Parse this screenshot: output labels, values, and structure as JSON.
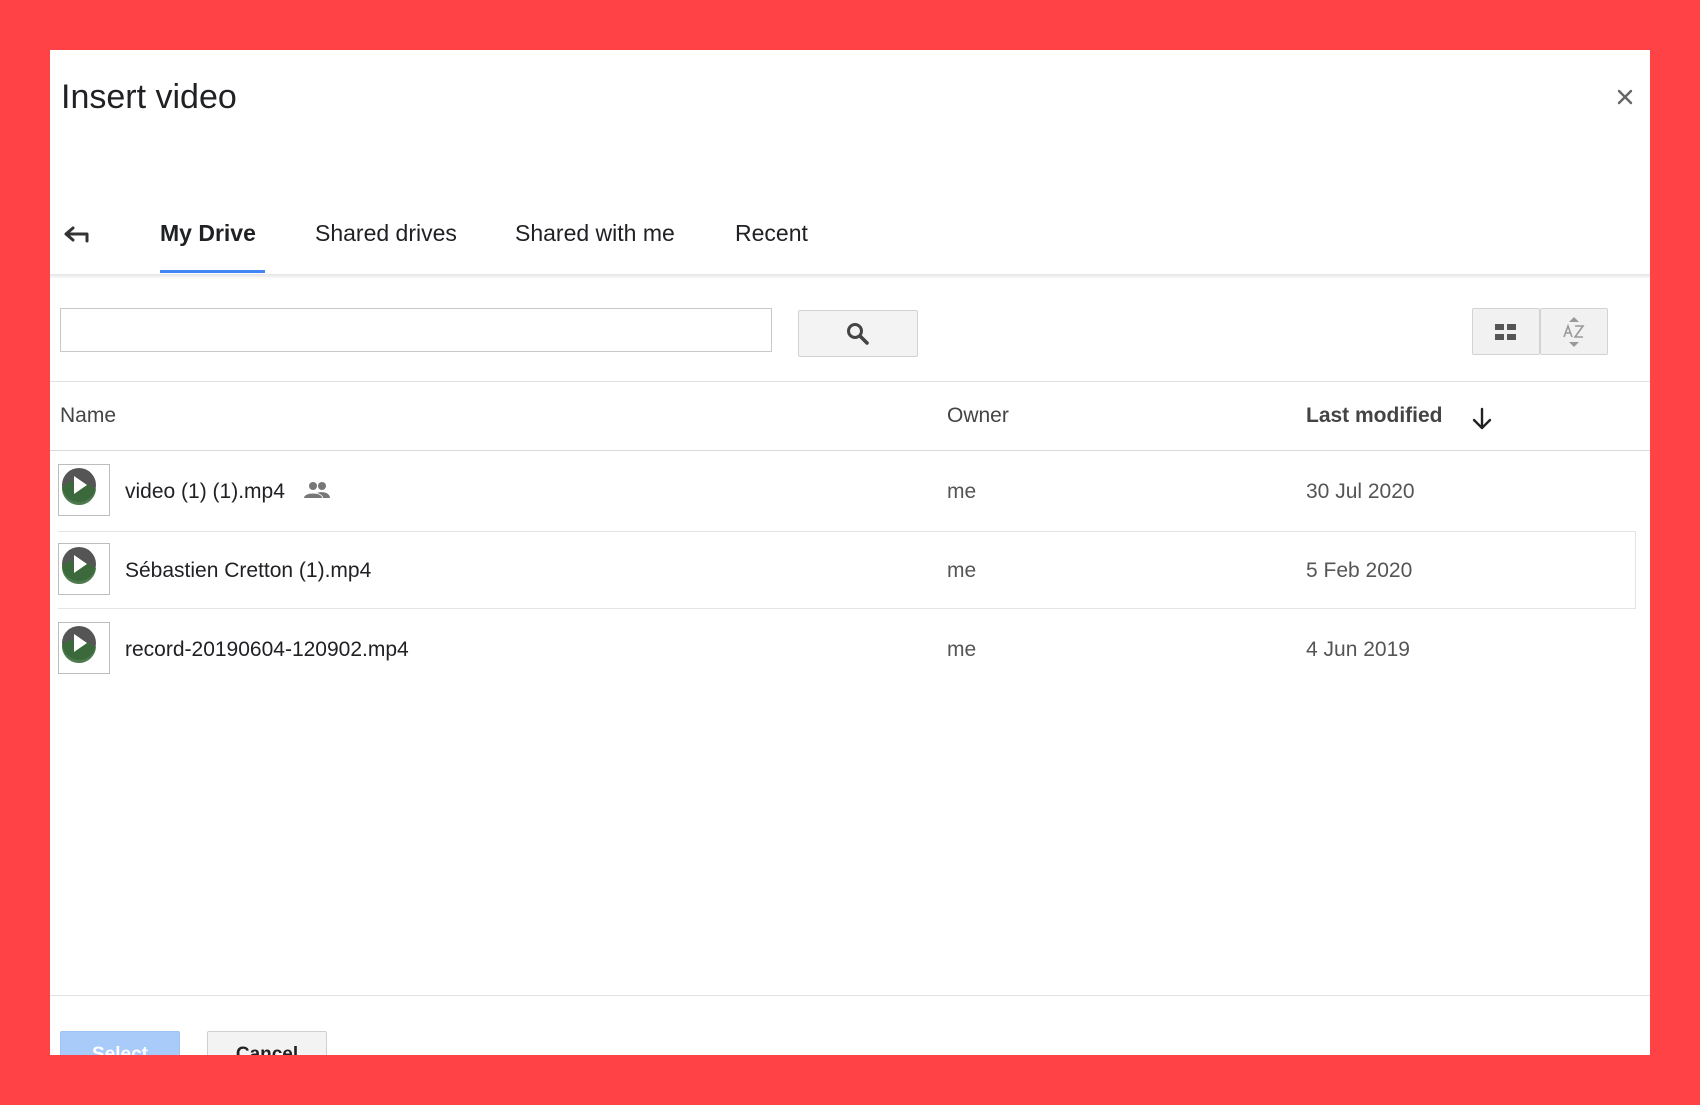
{
  "dialog": {
    "title": "Insert video",
    "close_icon": "close-icon",
    "back_icon": "back-arrow-icon"
  },
  "tabs": [
    {
      "label": "My Drive",
      "active": true
    },
    {
      "label": "Shared drives",
      "active": false
    },
    {
      "label": "Shared with me",
      "active": false
    },
    {
      "label": "Recent",
      "active": false
    }
  ],
  "toolbar": {
    "search_value": "",
    "search_icon": "search-icon",
    "grid_view_icon": "grid-view-icon",
    "sort_az_icon": "sort-az-icon"
  },
  "columns": {
    "name": "Name",
    "owner": "Owner",
    "last_modified": "Last modified",
    "sort_icon": "arrow-down-icon"
  },
  "files": [
    {
      "name": "video (1) (1).mp4",
      "owner": "me",
      "modified": "30 Jul 2020",
      "shared": true
    },
    {
      "name": "Sébastien Cretton (1).mp4",
      "owner": "me",
      "modified": "5 Feb 2020",
      "shared": false
    },
    {
      "name": "record-20190604-120902.mp4",
      "owner": "me",
      "modified": "4 Jun 2019",
      "shared": false
    }
  ],
  "footer": {
    "select_label": "Select",
    "cancel_label": "Cancel"
  },
  "colors": {
    "background": "#fe4245",
    "accent": "#4285f4",
    "select_disabled": "#a9cbfa"
  }
}
